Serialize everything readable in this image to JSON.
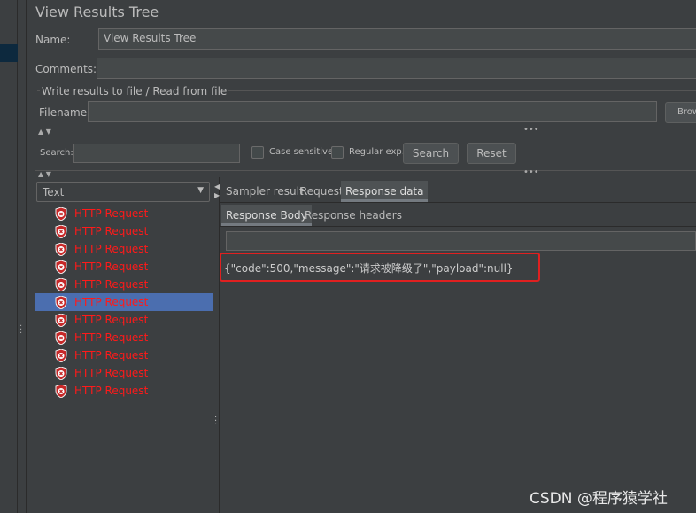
{
  "title": "View Results Tree",
  "name_label": "Name:",
  "name_value": "View Results Tree",
  "comments_label": "Comments:",
  "comments_value": "",
  "file_section": "Write results to file / Read from file",
  "filename_label": "Filename",
  "filename_value": "",
  "browse_label": "Brow",
  "search": {
    "label": "Search:",
    "value": "",
    "case_sensitive": "Case sensitive",
    "regex": "Regular exp.",
    "search_button": "Search",
    "reset_button": "Reset"
  },
  "renderer": "Text",
  "results": [
    {
      "label": "HTTP Request",
      "status": "error"
    },
    {
      "label": "HTTP Request",
      "status": "error"
    },
    {
      "label": "HTTP Request",
      "status": "error"
    },
    {
      "label": "HTTP Request",
      "status": "error"
    },
    {
      "label": "HTTP Request",
      "status": "error"
    },
    {
      "label": "HTTP Request",
      "status": "error",
      "selected": true
    },
    {
      "label": "HTTP Request",
      "status": "error"
    },
    {
      "label": "HTTP Request",
      "status": "error"
    },
    {
      "label": "HTTP Request",
      "status": "error"
    },
    {
      "label": "HTTP Request",
      "status": "error"
    },
    {
      "label": "HTTP Request",
      "status": "error"
    }
  ],
  "tabs": [
    "Sampler result",
    "Request",
    "Response data"
  ],
  "active_tab": "Response data",
  "subtabs": [
    "Response Body",
    "Response headers"
  ],
  "active_subtab": "Response Body",
  "response_body": "{\"code\":500,\"message\":\"请求被降级了\",\"payload\":null}",
  "highlight_color": "#e02020",
  "watermark": "CSDN @程序猿学社"
}
